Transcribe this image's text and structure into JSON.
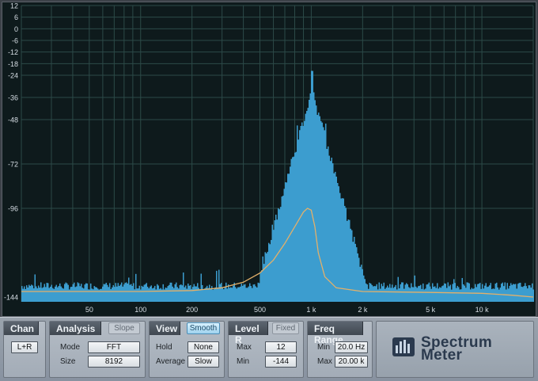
{
  "chart_data": {
    "type": "area",
    "y_ticks": [
      "12",
      "6",
      "0",
      "-6",
      "-12",
      "-18",
      "-24",
      "-36",
      "-48",
      "-72",
      "-96",
      "-144"
    ],
    "x_ticks": [
      {
        "freq": 50,
        "label": "50"
      },
      {
        "freq": 100,
        "label": "100"
      },
      {
        "freq": 200,
        "label": "200"
      },
      {
        "freq": 500,
        "label": "500"
      },
      {
        "freq": 1000,
        "label": "1 k"
      },
      {
        "freq": 2000,
        "label": "2 k"
      },
      {
        "freq": 5000,
        "label": "5 k"
      },
      {
        "freq": 10000,
        "label": "10 k"
      }
    ],
    "xlim": [
      20,
      20000
    ],
    "ylim": [
      -144,
      12
    ],
    "x_scale": "log",
    "grid": true,
    "peak": {
      "freq": 1000,
      "level_db": -22
    },
    "smooth_curve": [
      [
        20,
        -141
      ],
      [
        50,
        -141
      ],
      [
        100,
        -141
      ],
      [
        200,
        -140.5
      ],
      [
        300,
        -139
      ],
      [
        400,
        -136
      ],
      [
        500,
        -131
      ],
      [
        600,
        -124
      ],
      [
        700,
        -115
      ],
      [
        800,
        -106
      ],
      [
        900,
        -98
      ],
      [
        950,
        -96
      ],
      [
        1000,
        -97
      ],
      [
        1050,
        -106
      ],
      [
        1100,
        -120
      ],
      [
        1200,
        -133
      ],
      [
        1400,
        -139
      ],
      [
        2000,
        -141
      ],
      [
        5000,
        -141.5
      ],
      [
        10000,
        -142
      ],
      [
        15000,
        -143
      ],
      [
        20000,
        -144
      ]
    ],
    "colors": {
      "spectrum": "#3c9dcf",
      "curve": "#e3b06a",
      "grid": "#2c4a48",
      "background": "#0e1a1c"
    }
  },
  "panel": {
    "chan": {
      "title": "Chan",
      "button": "L+R"
    },
    "analysis": {
      "title": "Analysis",
      "slope_label": "Slope",
      "mode_label": "Mode",
      "mode_value": "FFT",
      "size_label": "Size",
      "size_value": "8192"
    },
    "view": {
      "title": "View",
      "smooth_label": "Smooth",
      "hold_label": "Hold",
      "hold_value": "None",
      "average_label": "Average",
      "average_value": "Slow"
    },
    "level": {
      "title": "Level R",
      "fixed_label": "Fixed",
      "max_label": "Max",
      "max_value": "12",
      "min_label": "Min",
      "min_value": "-144"
    },
    "freq": {
      "title": "Freq Range",
      "min_label": "Min",
      "min_value": "20.0 Hz",
      "max_label": "Max",
      "max_value": "20.00 k"
    },
    "brand": {
      "name": "Spectrum\nMeter"
    }
  }
}
